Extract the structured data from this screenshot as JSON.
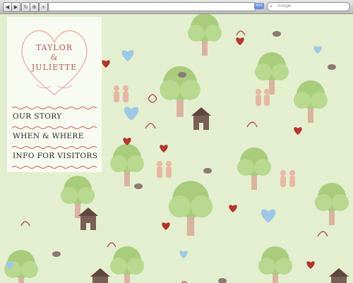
{
  "browser": {
    "search_placeholder": "Google",
    "rss_label": "RSS",
    "nav_icons": [
      "back-icon",
      "forward-icon",
      "reload-icon",
      "add-bookmark-icon",
      "new-tab-icon"
    ]
  },
  "site": {
    "logo_line1": "TAYLOR",
    "logo_ampersand": "&",
    "logo_line2": "JULIETTE",
    "menu": [
      {
        "label": "OUR STORY"
      },
      {
        "label": "WHEN & WHERE"
      },
      {
        "label": "INFO FOR VISITORS"
      }
    ]
  },
  "colors": {
    "background": "#e4efcf",
    "accent_red": "#b25a57",
    "heart_red": "#b5362e",
    "heart_blue": "#9fc8e4",
    "tree_green": "#a9cd7d",
    "trunk": "#d8b4a0",
    "house": "#7a5f56"
  }
}
